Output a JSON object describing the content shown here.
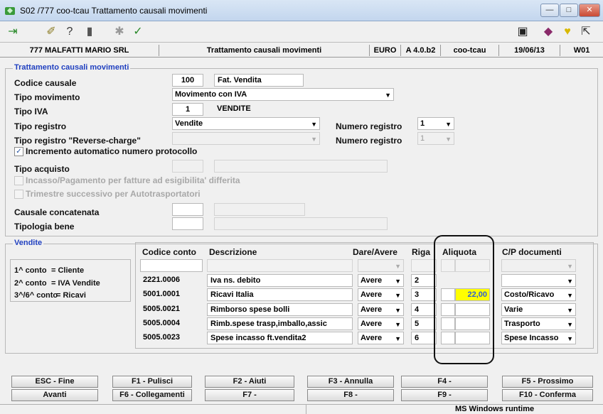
{
  "window": {
    "title": "S02 /777 coo-tcau Trattamento causali movimenti",
    "min": "—",
    "max": "□",
    "close": "✕"
  },
  "infobar": {
    "company": "777 MALFATTI MARIO SRL",
    "program": "Trattamento causali movimenti",
    "currency": "EURO",
    "version": "A 4.0.b2",
    "module": "coo-tcau",
    "date": "19/06/13",
    "workstation": "W01"
  },
  "form": {
    "group_title": "Trattamento causali movimenti",
    "codice_causale": {
      "label": "Codice causale",
      "code": "100",
      "desc": "Fat. Vendita"
    },
    "tipo_movimento": {
      "label": "Tipo movimento",
      "value": "Movimento con IVA"
    },
    "tipo_iva": {
      "label": "Tipo IVA",
      "code": "1",
      "desc": "VENDITE"
    },
    "tipo_registro": {
      "label": "Tipo registro",
      "value": "Vendite"
    },
    "numero_registro": {
      "label": "Numero registro",
      "value": "1"
    },
    "reverse_charge": {
      "label": "Tipo registro \"Reverse-charge\"",
      "value": ""
    },
    "numero_registro2": {
      "label": "Numero registro",
      "value": "1"
    },
    "incremento": {
      "label": "Incremento automatico numero protocollo",
      "checked": "✓"
    },
    "tipo_acquisto": {
      "label": "Tipo acquisto"
    },
    "incasso": {
      "label": "Incasso/Pagamento per fatture ad esigibilita' differita"
    },
    "trimestre": {
      "label": "Trimestre successivo per Autotrasportatori"
    },
    "causale_concatenata": {
      "label": "Causale concatenata"
    },
    "tipologia_bene": {
      "label": "Tipologia bene"
    }
  },
  "vendite": {
    "title": "Vendite",
    "legend": [
      {
        "k": "1^ conto",
        "v": "= Cliente"
      },
      {
        "k": "2^ conto",
        "v": "= IVA Vendite"
      },
      {
        "k": "3^/6^ conto",
        "v": "= Ricavi"
      }
    ],
    "headers": {
      "codice": "Codice conto",
      "descrizione": "Descrizione",
      "dare_avere": "Dare/Avere",
      "riga": "Riga",
      "aliquota": "Aliquota",
      "cp": "C/P documenti"
    },
    "rows": [
      {
        "codice": "",
        "descrizione": "",
        "dare_avere": "",
        "riga": "",
        "aliquota": "",
        "cp": ""
      },
      {
        "codice": "2221.0006",
        "descrizione": "Iva ns. debito",
        "dare_avere": "Avere",
        "riga": "2",
        "aliquota": "",
        "cp": ""
      },
      {
        "codice": "5001.0001",
        "descrizione": "Ricavi Italia",
        "dare_avere": "Avere",
        "riga": "3",
        "aliquota": "22,00",
        "cp": "Costo/Ricavo"
      },
      {
        "codice": "5005.0021",
        "descrizione": "Rimborso spese bolli",
        "dare_avere": "Avere",
        "riga": "4",
        "aliquota": "",
        "cp": "Varie"
      },
      {
        "codice": "5005.0004",
        "descrizione": "Rimb.spese trasp,imballo,assic",
        "dare_avere": "Avere",
        "riga": "5",
        "aliquota": "",
        "cp": "Trasporto"
      },
      {
        "codice": "5005.0023",
        "descrizione": "Spese incasso ft.vendita2",
        "dare_avere": "Avere",
        "riga": "6",
        "aliquota": "",
        "cp": "Spese Incasso"
      }
    ]
  },
  "fkeys": {
    "row1": [
      "ESC - Fine",
      "F1 - Pulisci",
      "F2 - Aiuti",
      "F3 - Annulla",
      "F4 -",
      "F5 - Prossimo"
    ],
    "row2": [
      "Avanti",
      "F6 - Collegamenti",
      "F7 -",
      "F8 -",
      "F9 -",
      "F10 - Conferma"
    ]
  },
  "status": {
    "runtime": "MS Windows runtime"
  },
  "colors": {
    "accent": "#2040c0",
    "selection": "#ffff00",
    "selected_text": "#3060d0"
  }
}
